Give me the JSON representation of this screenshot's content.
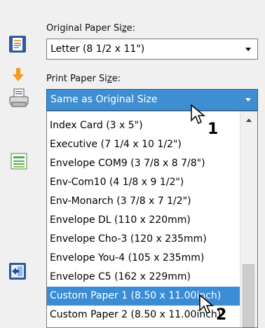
{
  "original": {
    "label_before": "Original Paper Si",
    "label_access": "z",
    "label_after": "e:",
    "value": "Letter (8 1/2 x 11\")"
  },
  "print": {
    "label_before": "Print Paper Si",
    "label_access": "z",
    "label_after": "e:",
    "value": "Same as Original Size"
  },
  "dropdown_options": [
    "Index Card (3 x 5\")",
    "Executive (7 1/4 x 10 1/2\")",
    "Envelope COM9 (3 7/8 x 8 7/8\")",
    "Env-Com10 (4 1/8 x 9 1/2\")",
    "Env-Monarch (3 7/8 x 7 1/2\")",
    "Envelope DL (110 x 220mm)",
    "Envelope Cho-3 (120 x 235mm)",
    "Envelope You-4 (105 x 235mm)",
    "Envelope C5 (162 x 229mm)",
    "Custom Paper 1 (8.50 x 11.00inch)",
    "Custom Paper 2 (8.50 x 11.00inch)"
  ],
  "selected_index": 9,
  "callouts": {
    "first": "1",
    "second": "2"
  },
  "icons": [
    "original-paper-icon",
    "down-arrow-icon",
    "printer-icon",
    "paper-stack-icon",
    "layout-arrow-icon",
    "cursor-icon"
  ],
  "colors": {
    "selection": "#3a8cd5",
    "arrow": "#f39b1b"
  }
}
